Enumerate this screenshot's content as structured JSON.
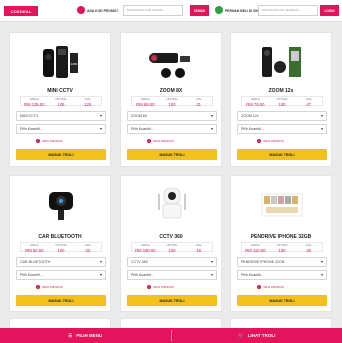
{
  "header": {
    "logo_text": "COSDEAL",
    "query_question": "ADA KOD PROMO?",
    "promo_placeholder": "MASUKKAN KOD DIASINI",
    "promo_button": "SEMAK",
    "tracking_question": "PERNAH BELI DI SINI?",
    "tracking_placeholder": "MASUKKAN NO TELEFON",
    "tracking_button": "LOGIN"
  },
  "price_labels": {
    "normal": "HARGA",
    "profit": "UNTUNG",
    "sell": "JUAL"
  },
  "products": [
    {
      "name": "MINI CCTV",
      "harga": "RM 135.00",
      "untung": "106",
      "jual": "125",
      "variant": "MINI CCTV",
      "qty": "Pilih Kuantiti...",
      "info": "INFO PRODUK",
      "button": "MASUK TROLI"
    },
    {
      "name": "ZOOM 8X",
      "harga": "RM 69.00",
      "untung": "100",
      "jual": "21",
      "variant": "ZOOM 8X",
      "qty": "Pilih Kuantiti...",
      "info": "INFO PRODUK",
      "button": "MASUK TROLI"
    },
    {
      "name": "ZOOM 12x",
      "harga": "RM 79.00",
      "untung": "100",
      "jual": "47",
      "variant": "ZOOM 12x",
      "qty": "Pilih Kuantiti...",
      "info": "INFO PRODUK",
      "button": "MASUK TROLI"
    },
    {
      "name": "CAR BLUETOOTH",
      "harga": "RM 80.00",
      "untung": "100",
      "jual": "33",
      "variant": "CAR BLUETOOTH",
      "qty": "Pilih Kuantiti...",
      "info": "INFO PRODUK",
      "button": "MASUK TROLI"
    },
    {
      "name": "CCTV 360",
      "harga": "RM 190.00",
      "untung": "100",
      "jual": "16",
      "variant": "CCTV 360",
      "qty": "Pilih Kuantiti...",
      "info": "INFO PRODUK",
      "button": "MASUK TROLI"
    },
    {
      "name": "PENDRIVE IPHONE 32GB",
      "harga": "RM 110.00",
      "untung": "100",
      "jual": "25",
      "variant": "PENDRIVE IPHONE 32GB",
      "qty": "Pilih Kuantiti...",
      "info": "INFO PRODUK",
      "button": "MASUK TROLI"
    }
  ],
  "footer": {
    "menu_label": "PILIH MENU",
    "cart_label": "LIHAT TROLI"
  },
  "colors": {
    "brand": "#e3135c",
    "button": "#f3c11c",
    "price": "#d6144e"
  }
}
